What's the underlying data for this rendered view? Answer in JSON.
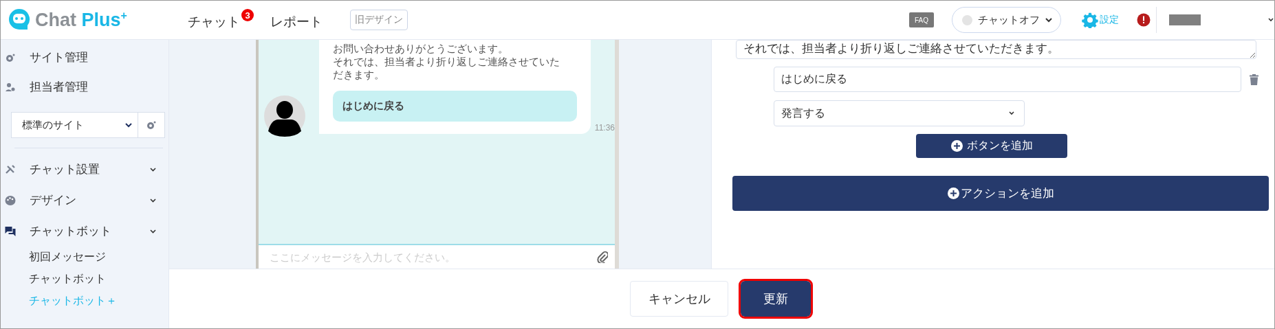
{
  "header": {
    "logo": {
      "first": "Chat",
      "second": "Plus",
      "sup": "+"
    },
    "nav": [
      {
        "label": "チャット",
        "badge": "3"
      },
      {
        "label": "レポート"
      }
    ],
    "old_design": "旧デザイン",
    "faq": "FAQ",
    "chat_status": {
      "label": "チャットオフ",
      "on": false
    },
    "settings": "設定"
  },
  "sidebar": {
    "top_items": [
      {
        "label": "サイト管理"
      },
      {
        "label": "担当者管理"
      }
    ],
    "site_select": "標準のサイト",
    "sections": [
      {
        "label": "チャット設置"
      },
      {
        "label": "デザイン"
      },
      {
        "label": "チャットボット",
        "children": [
          {
            "label": "初回メッセージ",
            "selected": false
          },
          {
            "label": "チャットボット",
            "selected": false
          },
          {
            "label": "チャットボット＋",
            "selected": true
          }
        ]
      }
    ]
  },
  "preview": {
    "message": [
      "お問い合わせありがとうございます。",
      "それでは、担当者より折り返しご連絡させていただきます。"
    ],
    "choice": "はじめに戻る",
    "time": "11:36",
    "input_placeholder": "ここにメッセージを入力してください。"
  },
  "editor": {
    "message": "それでは、担当者より折り返しご連絡させていただきます。",
    "button_label": "はじめに戻る",
    "action": "発言する",
    "add_button": "ボタンを追加",
    "add_action": "アクションを追加"
  },
  "footer": {
    "cancel": "キャンセル",
    "update": {
      "label": "更新",
      "highlighted": true
    }
  }
}
